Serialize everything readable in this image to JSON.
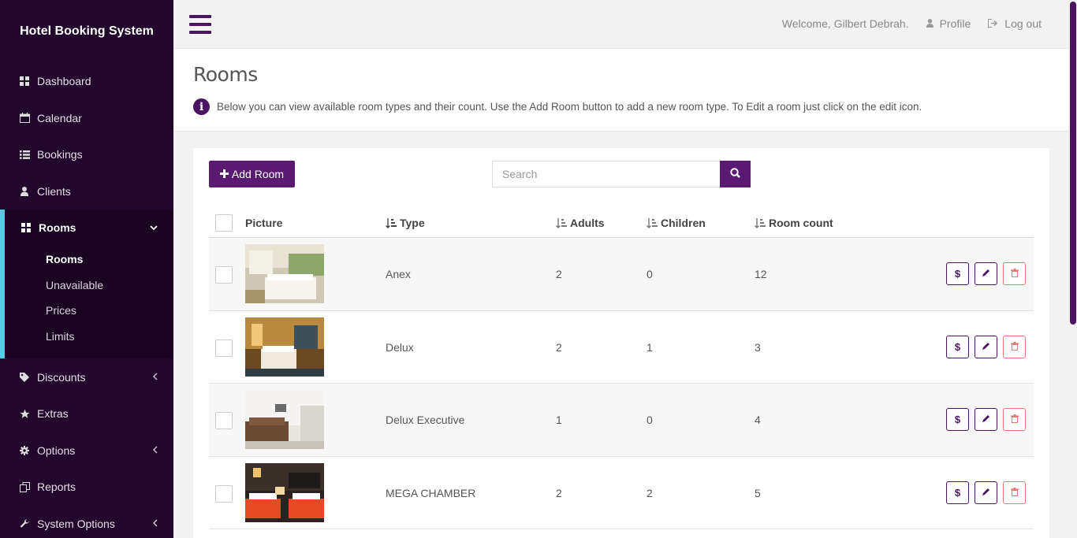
{
  "app": {
    "title": "Hotel Booking System"
  },
  "sidebar": {
    "items": [
      {
        "label": "Dashboard",
        "icon": "dashboard-icon"
      },
      {
        "label": "Calendar",
        "icon": "calendar-icon"
      },
      {
        "label": "Bookings",
        "icon": "list-icon"
      },
      {
        "label": "Clients",
        "icon": "user-icon"
      }
    ],
    "rooms_group": {
      "label": "Rooms",
      "icon": "dashboard-icon",
      "subitems": [
        "Rooms",
        "Unavailable",
        "Prices",
        "Limits"
      ]
    },
    "items_after": [
      {
        "label": "Discounts",
        "icon": "tag-icon",
        "has_chevron": true
      },
      {
        "label": "Extras",
        "icon": "star-icon",
        "has_chevron": false
      },
      {
        "label": "Options",
        "icon": "gear-icon",
        "has_chevron": true
      },
      {
        "label": "Reports",
        "icon": "copy-icon",
        "has_chevron": false
      },
      {
        "label": "System Options",
        "icon": "wrench-icon",
        "has_chevron": true
      }
    ]
  },
  "topbar": {
    "welcome": "Welcome, Gilbert Debrah.",
    "profile": "Profile",
    "logout": "Log out"
  },
  "page": {
    "title": "Rooms",
    "info": "Below you can view available room types and their count. Use the Add Room button to add a new room type. To Edit a room just click on the edit icon."
  },
  "toolbar": {
    "add_label": "Add Room",
    "search_placeholder": "Search"
  },
  "table": {
    "headers": {
      "picture": "Picture",
      "type": "Type",
      "adults": "Adults",
      "children": "Children",
      "room_count": "Room count"
    },
    "rows": [
      {
        "type": "Anex",
        "adults": "2",
        "children": "0",
        "room_count": "12"
      },
      {
        "type": "Delux",
        "adults": "2",
        "children": "1",
        "room_count": "3"
      },
      {
        "type": "Delux Executive",
        "adults": "1",
        "children": "0",
        "room_count": "4"
      },
      {
        "type": "MEGA CHAMBER",
        "adults": "2",
        "children": "2",
        "room_count": "5"
      }
    ],
    "action_price_label": "$"
  },
  "colors": {
    "sidebar": "#22062b",
    "accent": "#5b1a72",
    "highlight": "#5bc8e6",
    "danger": "#e07a7a"
  }
}
